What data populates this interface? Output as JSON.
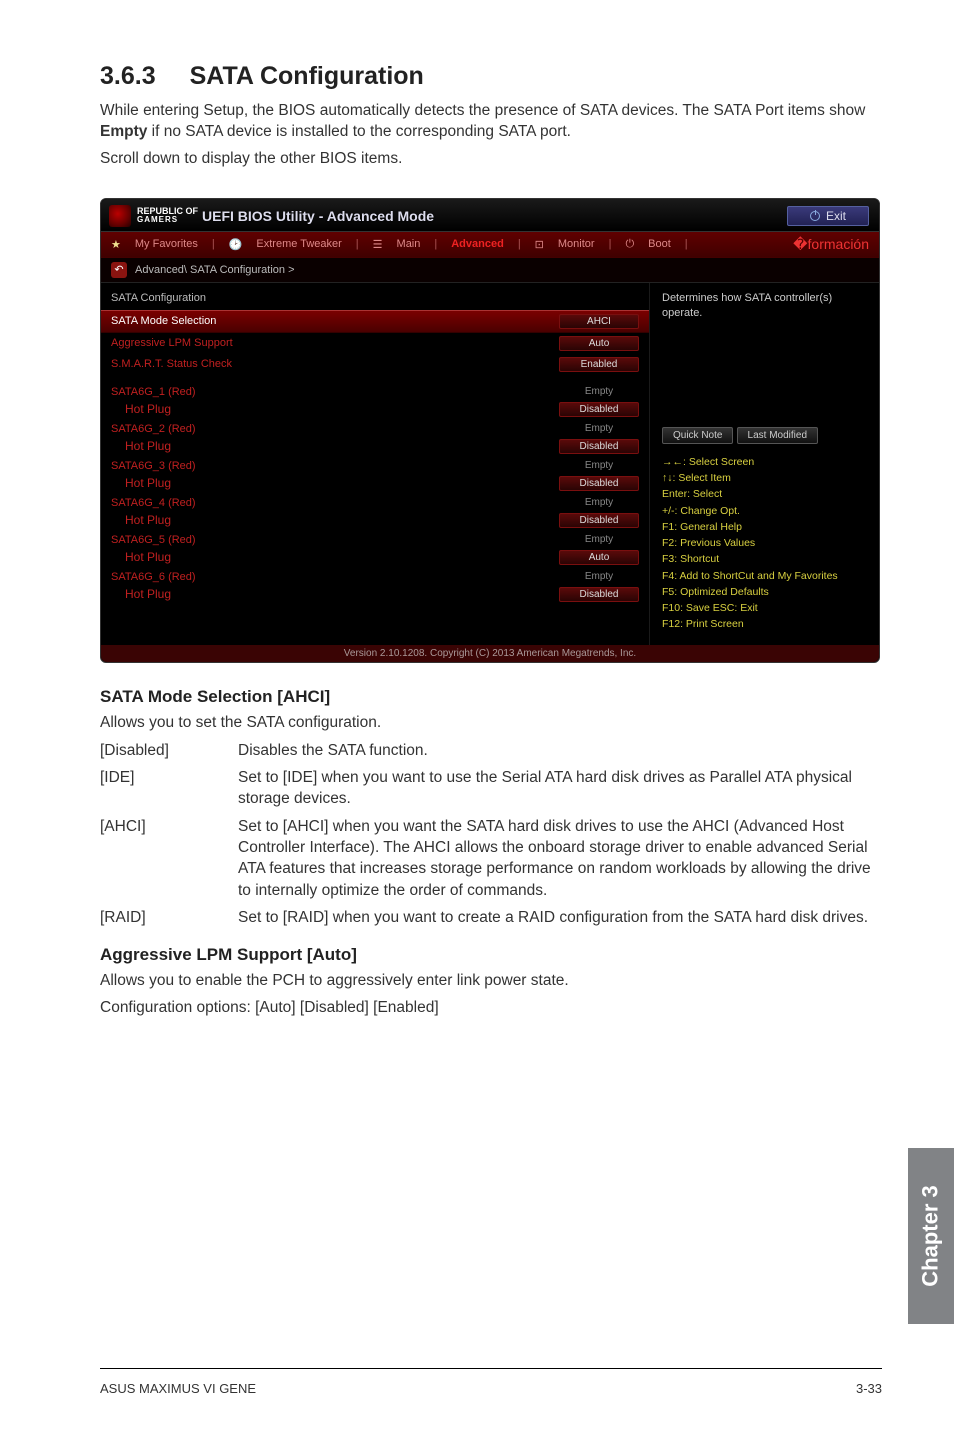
{
  "doc": {
    "section_number": "3.6.3",
    "section_title": "SATA Configuration",
    "intro_line1": "While entering Setup, the BIOS automatically detects the presence of SATA devices. The SATA Port items show ",
    "intro_bold": "Empty",
    "intro_line1_tail": " if no SATA device is installed to the corresponding SATA port.",
    "intro_line2": "Scroll down to display the other BIOS items.",
    "sub1_title": "SATA Mode Selection [AHCI]",
    "sub1_intro": "Allows you to set the SATA configuration.",
    "opts1": [
      {
        "k": "[Disabled]",
        "v": "Disables the SATA function."
      },
      {
        "k": "[IDE]",
        "v": "Set to [IDE] when you want to use the Serial ATA hard disk drives as Parallel ATA physical storage devices."
      },
      {
        "k": "[AHCI]",
        "v": "Set to [AHCI] when you want the SATA hard disk drives to use the AHCI (Advanced Host Controller Interface). The AHCI allows the onboard storage driver to enable advanced Serial ATA features that increases storage performance on random workloads by allowing the drive to internally optimize the order of commands."
      },
      {
        "k": "[RAID]",
        "v": "Set to [RAID] when you want to create a RAID configuration from the SATA hard disk drives."
      }
    ],
    "sub2_title": "Aggressive LPM Support [Auto]",
    "sub2_line1": "Allows you to enable the PCH to aggressively enter link power state.",
    "sub2_line2": "Configuration options: [Auto] [Disabled] [Enabled]",
    "chapter_tab": "Chapter 3",
    "footer_left": "ASUS MAXIMUS VI GENE",
    "footer_right": "3-33"
  },
  "bios": {
    "brand1": "REPUBLIC OF",
    "brand2": "GAMERS",
    "title": "UEFI BIOS Utility - Advanced Mode",
    "exit": "Exit",
    "tabs": {
      "fav": "My Favorites",
      "tweak": "Extreme Tweaker",
      "main": "Main",
      "advanced": "Advanced",
      "monitor": "Monitor",
      "boot": "Boot"
    },
    "breadcrumb": "Advanced\\ SATA Configuration >",
    "left": {
      "header": "SATA Configuration",
      "rows": [
        {
          "label": "SATA Mode Selection",
          "value": "AHCI",
          "pill": true,
          "selected": true
        },
        {
          "label": "Aggressive LPM Support",
          "value": "Auto",
          "pill": true
        },
        {
          "label": "S.M.A.R.T. Status Check",
          "value": "Enabled",
          "pill": true
        }
      ],
      "ports": [
        {
          "name": "SATA6G_1 (Red)",
          "status": "Empty",
          "hp_label": "Hot Plug",
          "hp_value": "Disabled"
        },
        {
          "name": "SATA6G_2 (Red)",
          "status": "Empty",
          "hp_label": "Hot Plug",
          "hp_value": "Disabled"
        },
        {
          "name": "SATA6G_3 (Red)",
          "status": "Empty",
          "hp_label": "Hot Plug",
          "hp_value": "Disabled"
        },
        {
          "name": "SATA6G_4 (Red)",
          "status": "Empty",
          "hp_label": "Hot Plug",
          "hp_value": "Disabled"
        },
        {
          "name": "SATA6G_5 (Red)",
          "status": "Empty",
          "hp_label": "Hot Plug",
          "hp_value": "Auto"
        },
        {
          "name": "SATA6G_6 (Red)",
          "status": "Empty",
          "hp_label": "Hot Plug",
          "hp_value": "Disabled"
        }
      ]
    },
    "right": {
      "desc": "Determines how SATA controller(s) operate.",
      "quick_note": "Quick Note",
      "last_modified": "Last Modified",
      "help": [
        "→←: Select Screen",
        "↑↓: Select Item",
        "Enter: Select",
        "+/-: Change Opt.",
        "F1: General Help",
        "F2: Previous Values",
        "F3: Shortcut",
        "F4: Add to ShortCut and My Favorites",
        "F5: Optimized Defaults",
        "F10: Save  ESC: Exit",
        "F12: Print Screen"
      ]
    },
    "footer": "Version 2.10.1208. Copyright (C) 2013 American Megatrends, Inc."
  }
}
